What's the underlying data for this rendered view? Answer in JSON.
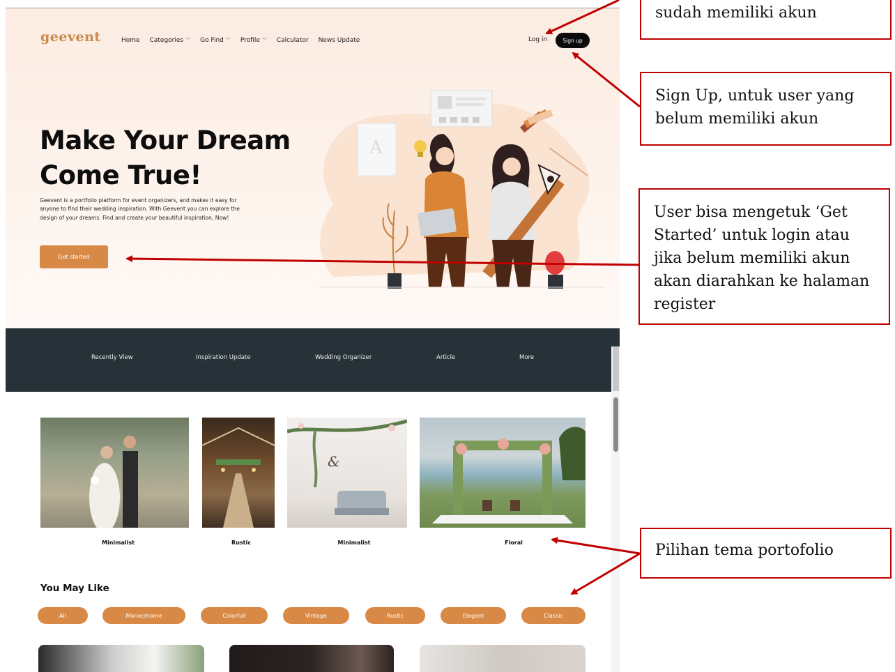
{
  "site": {
    "logo": "geevent",
    "nav": [
      {
        "label": "Home",
        "dropdown": false
      },
      {
        "label": "Categories",
        "dropdown": true
      },
      {
        "label": "Go Find",
        "dropdown": true
      },
      {
        "label": "Profile",
        "dropdown": true
      },
      {
        "label": "Calculator",
        "dropdown": false
      },
      {
        "label": "News Update",
        "dropdown": false
      }
    ],
    "login_label": "Log in",
    "signup_label": "Sign up",
    "hero": {
      "headline_line1": "Make Your Dream",
      "headline_line2": "Come True!",
      "description": "Geevent is a portfolio platform for event organizers, and makes it easy for anyone to find their wedding inspiration. With Geevent you can explore the design of your dreams. Find and create your beautiful inspiration, Now!",
      "cta_label": "Get started"
    },
    "category_bar": [
      "Recently View",
      "Inspiration Update",
      "Wedding Organizer",
      "Article",
      "More"
    ],
    "themes": [
      {
        "label": "Minimalist"
      },
      {
        "label": "Rustic"
      },
      {
        "label": "Minimalist"
      },
      {
        "label": "Floral"
      }
    ],
    "you_may_like": {
      "title": "You May Like",
      "filters": [
        "All",
        "Monocrhome",
        "Colorfull",
        "Vintage",
        "Rustic",
        "Elegant",
        "Classic"
      ]
    },
    "colors": {
      "accent": "#d88945",
      "dark_bar": "#263238",
      "logo": "#c98a4b",
      "annotation_border": "#c00000"
    }
  },
  "annotations": {
    "login_note": "sudah memiliki akun",
    "signup_note": "Sign Up, untuk user yang belum memiliki akun",
    "getstarted_note": "User bisa mengetuk ‘Get Started’ untuk login atau jika belum memiliki akun akan diarahkan ke halaman register",
    "theme_note": "Pilihan tema portofolio"
  }
}
